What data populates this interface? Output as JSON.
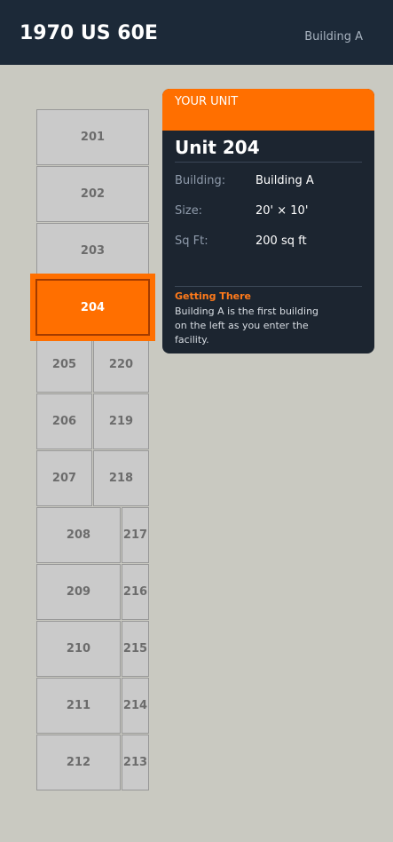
{
  "header": {
    "title": "1970 US 60E",
    "building": "Building A"
  },
  "units": [
    "201",
    "202",
    "203",
    "204",
    "205",
    "220",
    "206",
    "219",
    "207",
    "218",
    "208",
    "217",
    "209",
    "216",
    "210",
    "215",
    "211",
    "214",
    "212",
    "213"
  ],
  "selected_unit": "204",
  "card": {
    "badge": "YOUR UNIT",
    "unit_name": "Unit 204",
    "rows": [
      {
        "label": "Building:",
        "value": "Building A"
      },
      {
        "label": "Size:",
        "value": "20' × 10'"
      },
      {
        "label": "Sq Ft:",
        "value": "200 sq ft"
      }
    ],
    "getting_there_title": "Getting There",
    "getting_there_text": "Building A is the first building on the left as you enter the facility."
  },
  "colors": {
    "accent": "#ff6f00",
    "header_bg": "#1c2938",
    "card_bg": "#1c2530",
    "map_bg": "#c9c9c1"
  }
}
